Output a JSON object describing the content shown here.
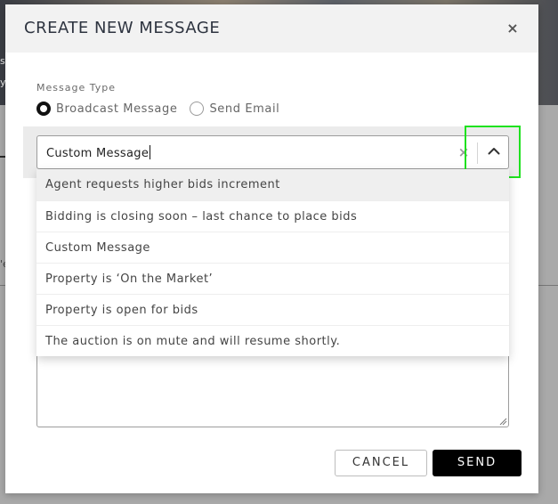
{
  "modal": {
    "title": "CREATE NEW MESSAGE",
    "close_symbol": "×"
  },
  "message_type": {
    "label": "Message Type",
    "options": [
      {
        "label": "Broadcast Message",
        "selected": true
      },
      {
        "label": "Send Email",
        "selected": false
      }
    ]
  },
  "combo": {
    "value": "Custom Message",
    "clear_symbol": "×",
    "expanded": true
  },
  "dropdown": {
    "items": [
      "Agent requests higher bids increment",
      "Bidding is closing soon – last chance to place bids",
      "Custom Message",
      "Property is ‘On the Market’",
      "Property is open for bids",
      "The auction is on mute and will resume shortly."
    ],
    "highlighted_index": 0
  },
  "actions": {
    "cancel_label": "CANCEL",
    "send_label": "SEND"
  },
  "background_fragments": {
    "left_char_1": "s",
    "left_char_2": "y",
    "left_char_3": "'e"
  },
  "colors": {
    "highlight": "#1fe21f",
    "send_bg": "#000000",
    "header_bg": "#f2f2f2"
  }
}
